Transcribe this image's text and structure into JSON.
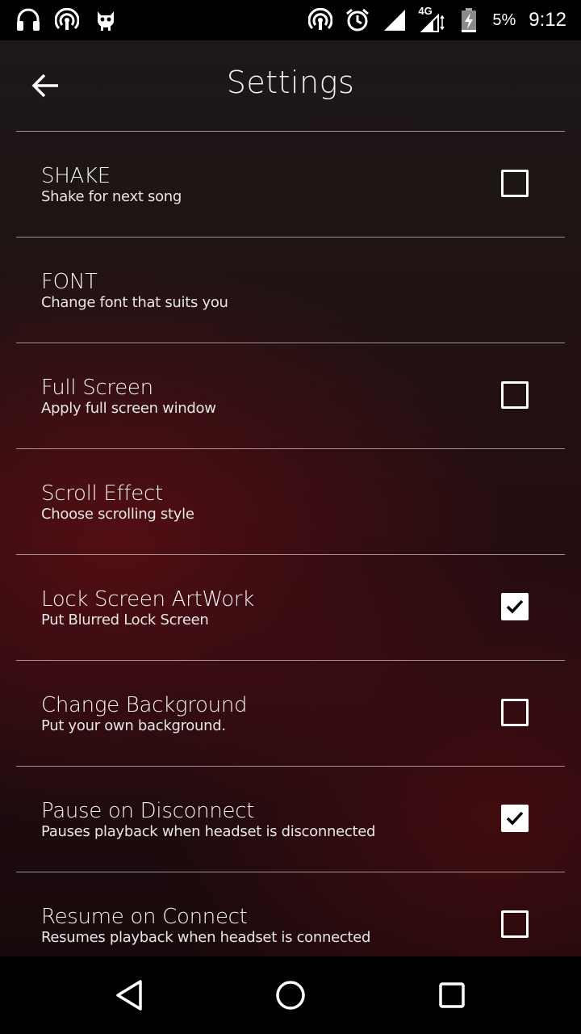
{
  "status_bar": {
    "left_icons": [
      "headphones-icon",
      "hotspot-icon",
      "cyanogen-mod-icon"
    ],
    "right_icons": [
      "hotspot-icon",
      "alarm-icon",
      "signal-icon",
      "network-4g-icon",
      "battery-charging-icon"
    ],
    "network_label": "4G",
    "battery_percent": "5%",
    "time": "9:12"
  },
  "app_bar": {
    "back_icon": "arrow-left-icon",
    "title": "Settings"
  },
  "settings": [
    {
      "title": "SHAKE",
      "subtitle": "Shake for next song",
      "has_checkbox": true,
      "checked": false
    },
    {
      "title": "FONT",
      "subtitle": "Change font that suits you",
      "has_checkbox": false,
      "checked": false
    },
    {
      "title": "Full Screen",
      "subtitle": "Apply full screen window",
      "has_checkbox": true,
      "checked": false
    },
    {
      "title": "Scroll Effect",
      "subtitle": "Choose scrolling style",
      "has_checkbox": false,
      "checked": false
    },
    {
      "title": "Lock Screen ArtWork",
      "subtitle": "Put Blurred Lock Screen",
      "has_checkbox": true,
      "checked": true
    },
    {
      "title": "Change Background",
      "subtitle": "Put your own background.",
      "has_checkbox": true,
      "checked": false
    },
    {
      "title": "Pause on Disconnect",
      "subtitle": "Pauses playback when headset is disconnected",
      "has_checkbox": true,
      "checked": true
    },
    {
      "title": "Resume on Connect",
      "subtitle": "Resumes playback when headset is connected",
      "has_checkbox": true,
      "checked": false
    }
  ],
  "nav_bar": {
    "buttons": [
      "back-triangle-icon",
      "home-circle-icon",
      "recents-square-icon"
    ]
  },
  "colors": {
    "accent_red": "#240d10",
    "text": "#ffffff"
  }
}
